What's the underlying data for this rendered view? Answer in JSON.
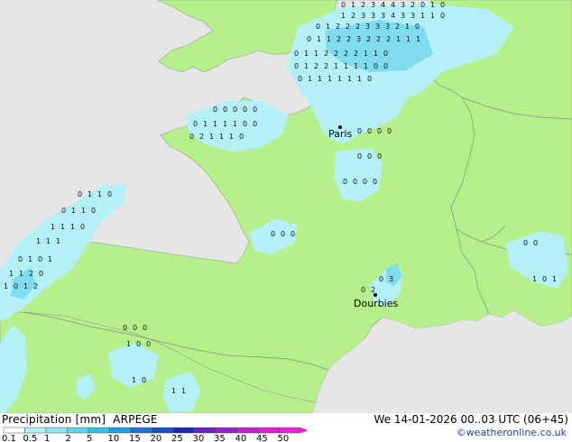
{
  "map": {
    "city_labels": [
      "Paris",
      "Dourbies"
    ]
  },
  "legend": {
    "title": "Precipitation [mm]",
    "model": "ARPEGE",
    "date": "We 14-01-2026 00..03 UTC (06+45)",
    "credit": "©weatheronline.co.uk",
    "scale_labels": [
      "0.1",
      "0.5",
      "1",
      "2",
      "5",
      "10",
      "15",
      "20",
      "25",
      "30",
      "35",
      "40",
      "45",
      "50"
    ],
    "scale_colors": [
      "#ffffff",
      "#b4f0f8",
      "#8ce6f5",
      "#5ed5f0",
      "#2ec1e8",
      "#1d9ee0",
      "#1d72d6",
      "#1c4dc8",
      "#1d28b5",
      "#6a1fc2",
      "#9a1fcc",
      "#c21fd0",
      "#e01fd2",
      "#f01fd8"
    ]
  },
  "colors": {
    "land": "#b6f08a",
    "sea": "#e6e6e6",
    "precip_light": "#b4f0f8",
    "precip_medium": "#7fdcef"
  }
}
